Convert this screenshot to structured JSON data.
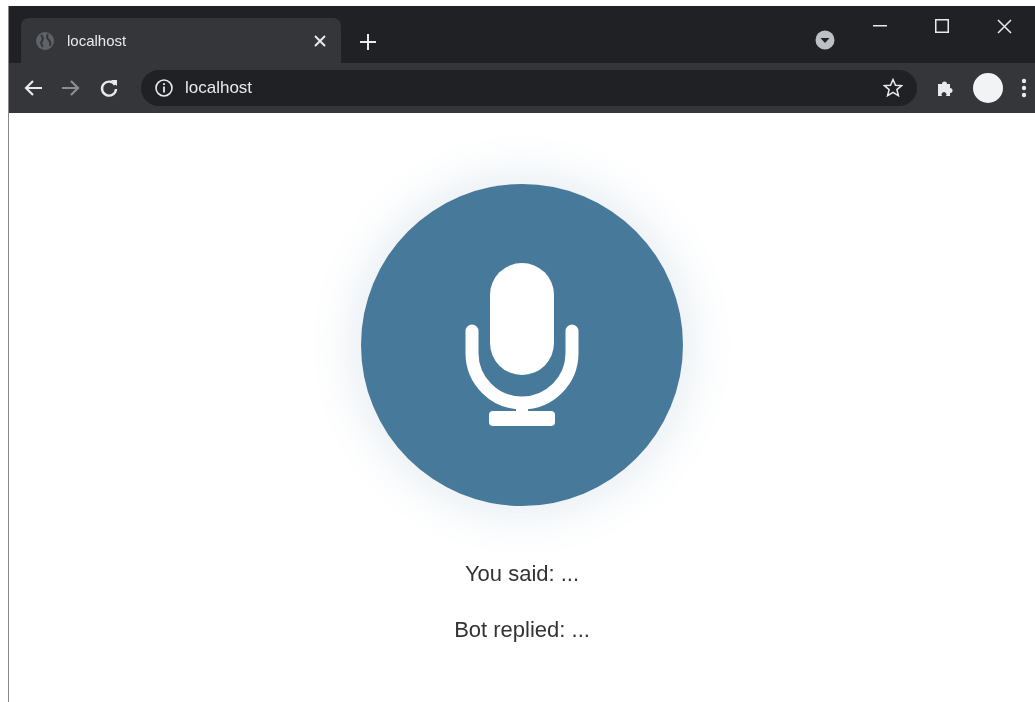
{
  "browser": {
    "tabs": [
      {
        "title": "localhost",
        "selected": true
      }
    ],
    "address": "localhost"
  },
  "page": {
    "lines": [
      "You said: ...",
      "Bot replied: ..."
    ]
  }
}
